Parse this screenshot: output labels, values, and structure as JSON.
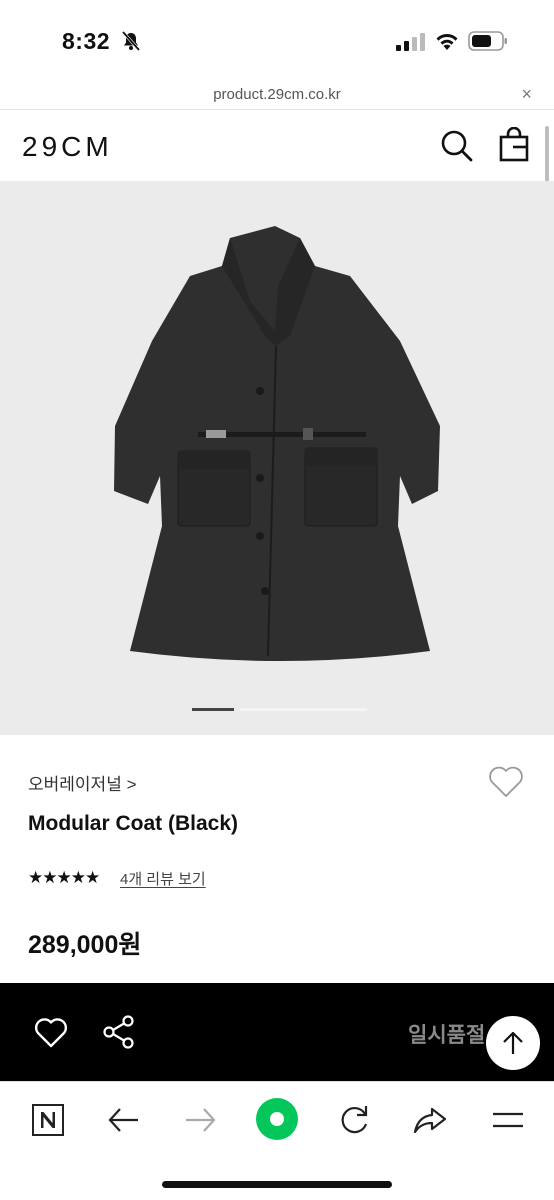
{
  "status": {
    "time": "8:32"
  },
  "browser": {
    "url": "product.29cm.co.kr",
    "close_symbol": "×"
  },
  "header": {
    "logo": "29CM",
    "icons": [
      "search-icon",
      "shopping-bag-icon"
    ]
  },
  "gallery": {
    "image": "black-modular-coat-icon",
    "slide_count_active": 1
  },
  "product": {
    "brand": "오버레이저널 >",
    "name": "Modular Coat (Black)",
    "rating_stars": "★★★★★",
    "review_link": "4개 리뷰 보기",
    "price": "289,000원"
  },
  "action_bar": {
    "status_label": "일시품절",
    "icons": [
      "heart-icon",
      "share-icon",
      "arrow-up-icon"
    ]
  },
  "bottom_nav": {
    "icons": [
      "naver-n-icon",
      "back-arrow-icon",
      "forward-arrow-icon",
      "green-home-icon",
      "refresh-icon",
      "share-arrow-icon",
      "menu-icon"
    ]
  },
  "colors": {
    "accent_green": "#03c75a",
    "action_bar": "#000000",
    "hero_bg": "#ebebeb"
  }
}
